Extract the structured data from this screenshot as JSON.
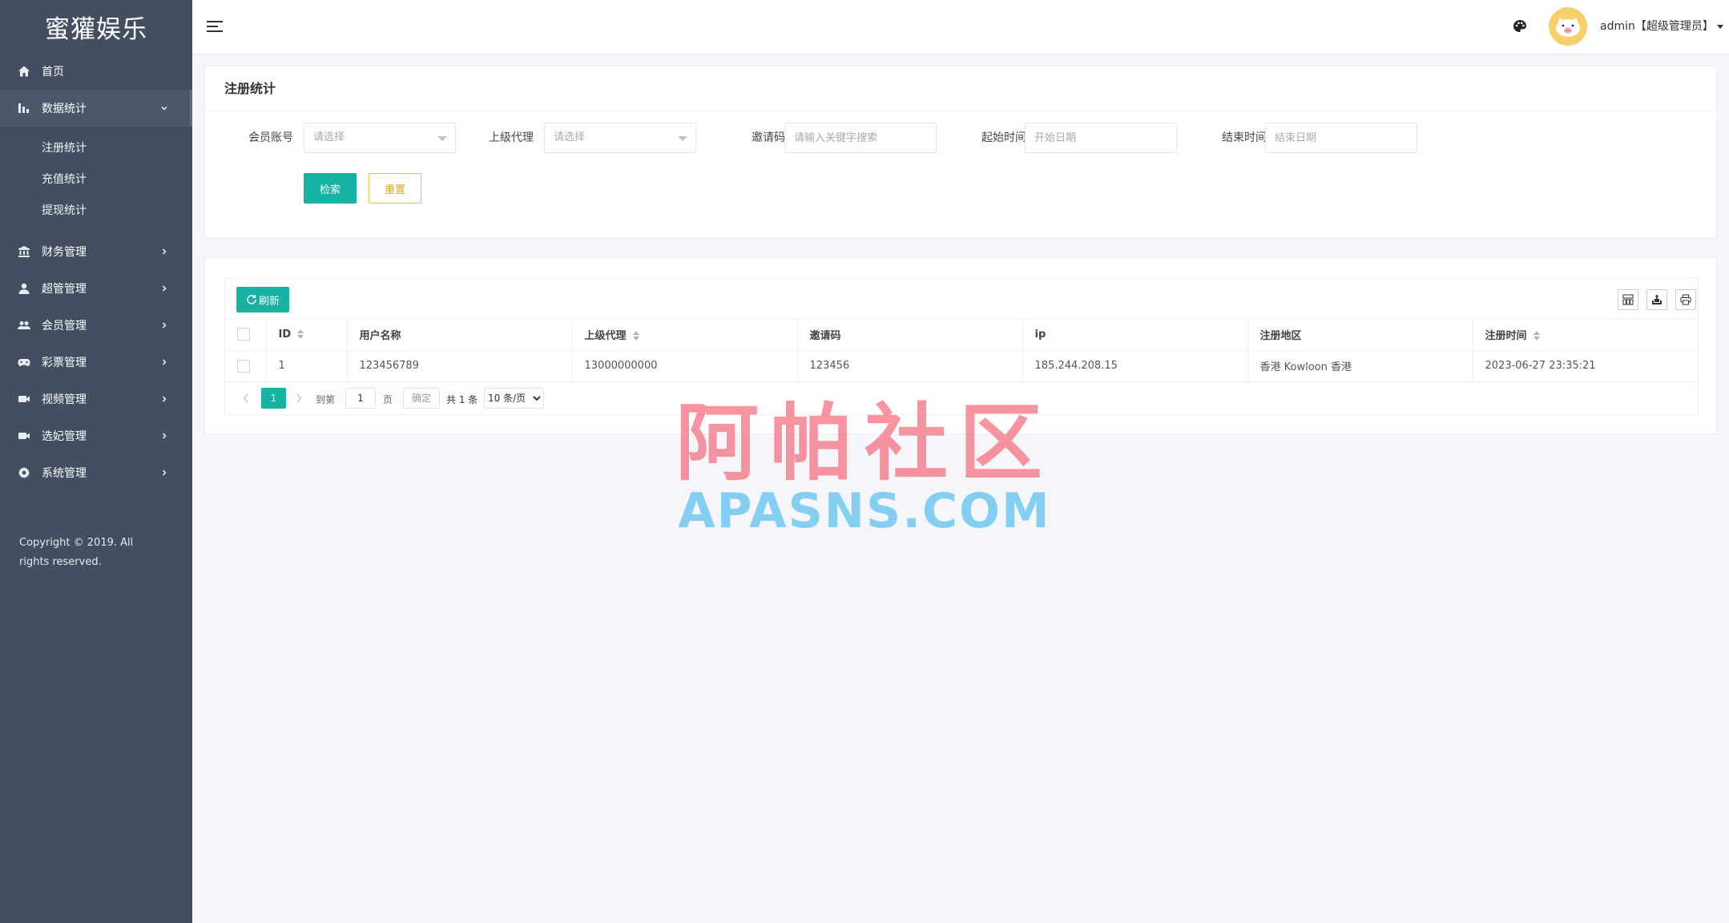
{
  "brand": "蜜獾娱乐",
  "sidebar": {
    "items": [
      {
        "label": "首页",
        "icon": "home-icon"
      },
      {
        "label": "数据统计",
        "icon": "bar-chart-icon",
        "active": true,
        "expanded": true,
        "children": [
          {
            "label": "注册统计"
          },
          {
            "label": "充值统计"
          },
          {
            "label": "提现统计"
          }
        ]
      },
      {
        "label": "财务管理",
        "icon": "bank-icon"
      },
      {
        "label": "超管管理",
        "icon": "user-icon"
      },
      {
        "label": "会员管理",
        "icon": "users-icon"
      },
      {
        "label": "彩票管理",
        "icon": "gamepad-icon"
      },
      {
        "label": "视频管理",
        "icon": "video-icon"
      },
      {
        "label": "选妃管理",
        "icon": "video-icon"
      },
      {
        "label": "系统管理",
        "icon": "gear-icon"
      }
    ],
    "copyright": "Copyright © 2019. All rights reserved."
  },
  "header": {
    "user": "admin【超级管理员】"
  },
  "search": {
    "title": "注册统计",
    "fields": [
      {
        "label": "会员账号",
        "placeholder": "请选择",
        "type": "select"
      },
      {
        "label": "上级代理",
        "placeholder": "请选择",
        "type": "select"
      },
      {
        "label": "邀请码",
        "placeholder": "请输入关键字搜索",
        "type": "text"
      },
      {
        "label": "起始时间",
        "placeholder": "开始日期",
        "type": "date"
      },
      {
        "label": "结束时间",
        "placeholder": "结束日期",
        "type": "date"
      }
    ],
    "search_label": "检索",
    "reset_label": "重置"
  },
  "table": {
    "refresh_label": "刷新",
    "columns": [
      {
        "label": "ID",
        "sortable": true
      },
      {
        "label": "用户名称",
        "sortable": false
      },
      {
        "label": "上级代理",
        "sortable": true
      },
      {
        "label": "邀请码",
        "sortable": false
      },
      {
        "label": "ip",
        "sortable": false
      },
      {
        "label": "注册地区",
        "sortable": false
      },
      {
        "label": "注册时间",
        "sortable": true
      }
    ],
    "rows": [
      [
        "1",
        "123456789",
        "13000000000",
        "123456",
        "185.244.208.15",
        "香港 Kowloon 香港",
        "2023-06-27 23:35:21"
      ]
    ]
  },
  "pager": {
    "current": "1",
    "goto_label": "到第",
    "page_value": "1",
    "page_unit": "页",
    "confirm_label": "确定",
    "total": "共 1 条",
    "page_size": "10 条/页"
  },
  "watermark": {
    "cn": "阿帕社区",
    "en": "APASNS.COM"
  },
  "colors": {
    "sidebar": "#434f60",
    "accent": "#16b3a2",
    "reset": "#d7a52a",
    "avatar": "#f7d06e"
  }
}
